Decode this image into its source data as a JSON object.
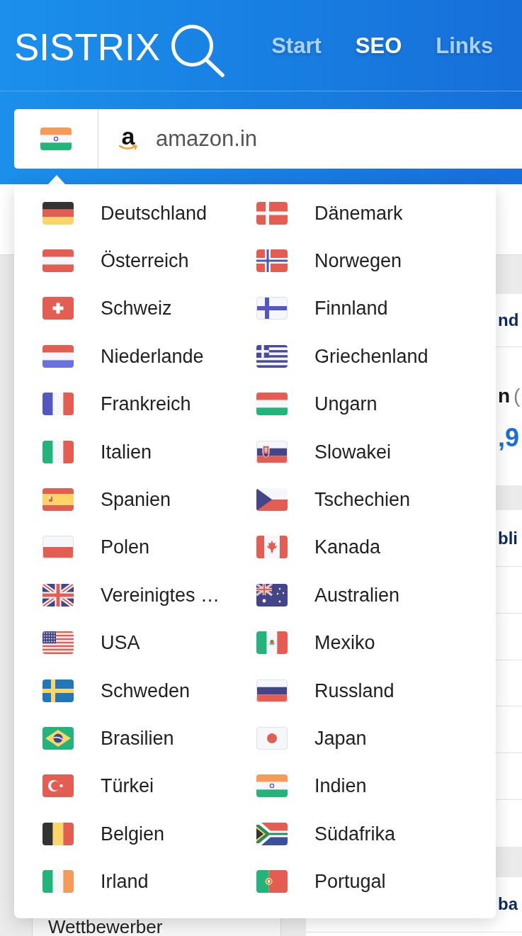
{
  "header": {
    "logo": "SISTRIX",
    "nav": [
      {
        "label": "Start",
        "selected": false
      },
      {
        "label": "SEO",
        "selected": true
      },
      {
        "label": "Links",
        "selected": false
      }
    ]
  },
  "search": {
    "country": {
      "kind": "in"
    },
    "favicon_letter": "a",
    "value": "amazon.in"
  },
  "country_menu": {
    "columns": [
      {
        "items": [
          {
            "label": "Deutschland",
            "kind": "de"
          },
          {
            "label": "Österreich",
            "kind": "at"
          },
          {
            "label": "Schweiz",
            "kind": "ch"
          },
          {
            "label": "Niederlande",
            "kind": "nl"
          },
          {
            "label": "Frankreich",
            "kind": "fr"
          },
          {
            "label": "Italien",
            "kind": "it"
          },
          {
            "label": "Spanien",
            "kind": "es"
          },
          {
            "label": "Polen",
            "kind": "pl"
          },
          {
            "label": "Vereinigtes …",
            "kind": "gb"
          },
          {
            "label": "USA",
            "kind": "us"
          },
          {
            "label": "Schweden",
            "kind": "se"
          },
          {
            "label": "Brasilien",
            "kind": "br"
          },
          {
            "label": "Türkei",
            "kind": "tr"
          },
          {
            "label": "Belgien",
            "kind": "be"
          },
          {
            "label": "Irland",
            "kind": "ie"
          }
        ]
      },
      {
        "items": [
          {
            "label": "Dänemark",
            "kind": "dk"
          },
          {
            "label": "Norwegen",
            "kind": "no"
          },
          {
            "label": "Finnland",
            "kind": "fi"
          },
          {
            "label": "Griechenland",
            "kind": "gr"
          },
          {
            "label": "Ungarn",
            "kind": "hu"
          },
          {
            "label": "Slowakei",
            "kind": "sk"
          },
          {
            "label": "Tschechien",
            "kind": "cz"
          },
          {
            "label": "Kanada",
            "kind": "ca"
          },
          {
            "label": "Australien",
            "kind": "au"
          },
          {
            "label": "Mexiko",
            "kind": "mx"
          },
          {
            "label": "Russland",
            "kind": "ru"
          },
          {
            "label": "Japan",
            "kind": "jp"
          },
          {
            "label": "Indien",
            "kind": "in"
          },
          {
            "label": "Südafrika",
            "kind": "za"
          },
          {
            "label": "Portugal",
            "kind": "pt"
          }
        ]
      }
    ]
  },
  "content": {
    "sidebar": [
      {
        "label": "Wettbewerber"
      }
    ],
    "panels": [
      {
        "kind": "metric",
        "heading": "nd",
        "label": "n",
        "qualifier": "(",
        "value": ",9"
      },
      {
        "kind": "table",
        "heading": "bli"
      },
      {
        "kind": "plain",
        "heading": "ba"
      }
    ]
  }
}
